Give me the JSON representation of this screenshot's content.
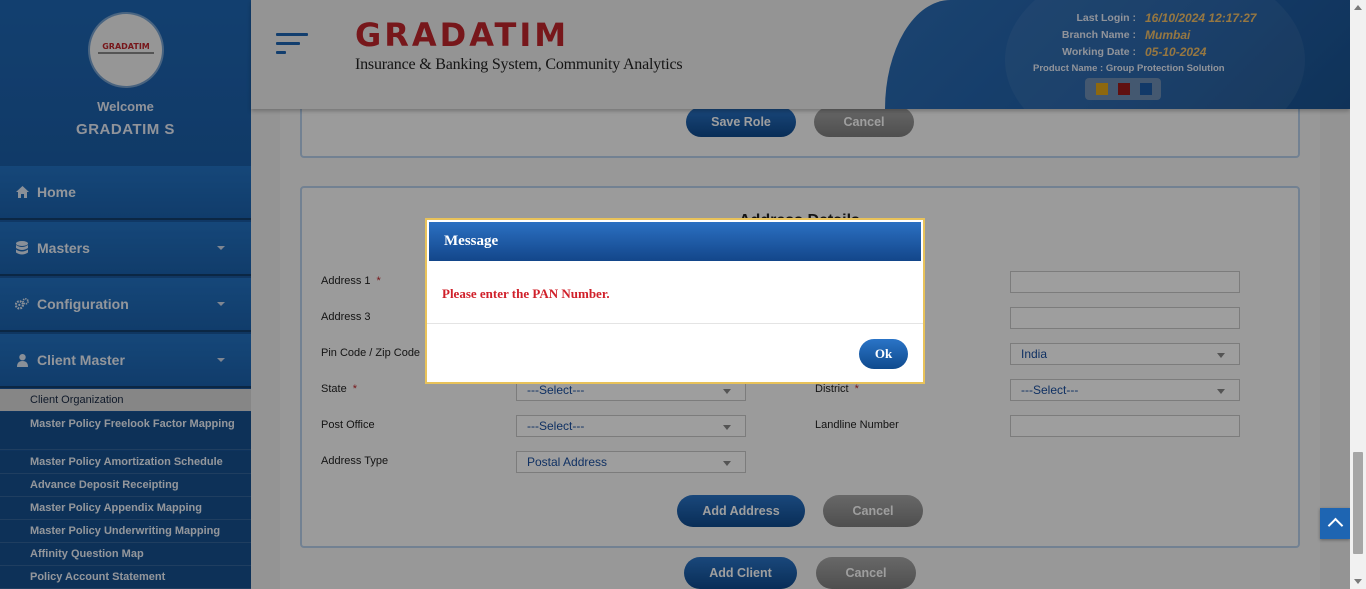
{
  "sidebar": {
    "logo_text": "GRADATIM",
    "welcome": "Welcome",
    "user_name": "GRADATIM S",
    "nav": [
      {
        "label": "Home",
        "icon": "home-icon"
      },
      {
        "label": "Masters",
        "icon": "database-icon"
      },
      {
        "label": "Configuration",
        "icon": "gears-icon"
      },
      {
        "label": "Client Master",
        "icon": "user-icon"
      }
    ],
    "submenu": [
      "Client Organization",
      "Master Policy Freelook Factor Mapping",
      "Master Policy Amortization Schedule",
      "Advance Deposit Receipting",
      "Master Policy Appendix Mapping",
      "Master Policy Underwriting Mapping",
      "Affinity Question Map",
      "Policy Account Statement"
    ]
  },
  "header": {
    "brand_name": "GRADATIM",
    "brand_tagline": "Insurance & Banking System, Community Analytics",
    "last_login_label": "Last Login :",
    "last_login_value": "16/10/2024 12:17:27",
    "branch_label": "Branch Name :",
    "branch_value": "Mumbai",
    "working_date_label": "Working Date :",
    "working_date_value": "05-10-2024",
    "product_name": "Product Name : Group Protection Solution",
    "theme_colors": [
      "#e6a817",
      "#9b1b1b",
      "#1e5ca8"
    ]
  },
  "role_section": {
    "save_label": "Save Role",
    "cancel_label": "Cancel"
  },
  "address_section": {
    "title": "Address Details",
    "fields": {
      "address1": "Address 1",
      "address3": "Address 3",
      "pincode": "Pin Code / Zip Code",
      "state": "State",
      "post_office": "Post Office",
      "address_type": "Address Type",
      "district": "District",
      "landline": "Landline Number"
    },
    "country_value": "India",
    "state_value": "---Select---",
    "post_office_value": "---Select---",
    "address_type_value": "Postal Address",
    "district_value": "---Select---",
    "add_address_label": "Add Address",
    "cancel_label": "Cancel"
  },
  "footer_actions": {
    "add_client_label": "Add Client",
    "cancel_label": "Cancel"
  },
  "modal": {
    "title": "Message",
    "message": "Please enter the PAN Number.",
    "ok_label": "Ok"
  }
}
